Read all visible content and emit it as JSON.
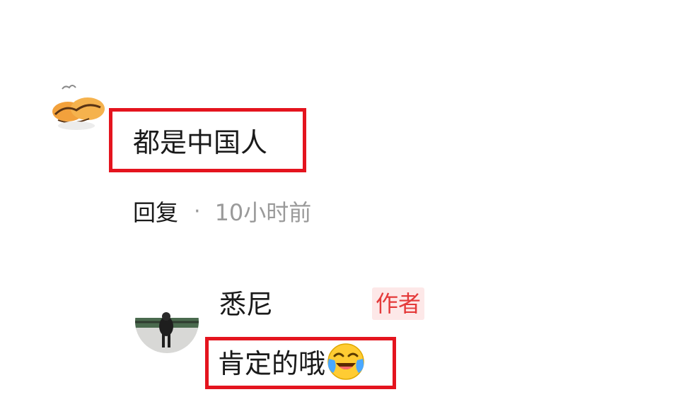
{
  "comment": {
    "avatar_icon": "user-avatar-icon",
    "text": "都是中国人",
    "reply_label": "回复",
    "separator": "·",
    "time": "10小时前"
  },
  "reply": {
    "avatar_icon": "user-avatar-icon",
    "username": "悉尼",
    "author_badge": "作者",
    "text": "肯定的哦",
    "emoji_icon": "crying-laughing-emoji-icon"
  },
  "colors": {
    "highlight": "#e4141e",
    "badge_text": "#e43a3a",
    "badge_bg": "#fde8e8",
    "muted_text": "#9a9a9a"
  }
}
